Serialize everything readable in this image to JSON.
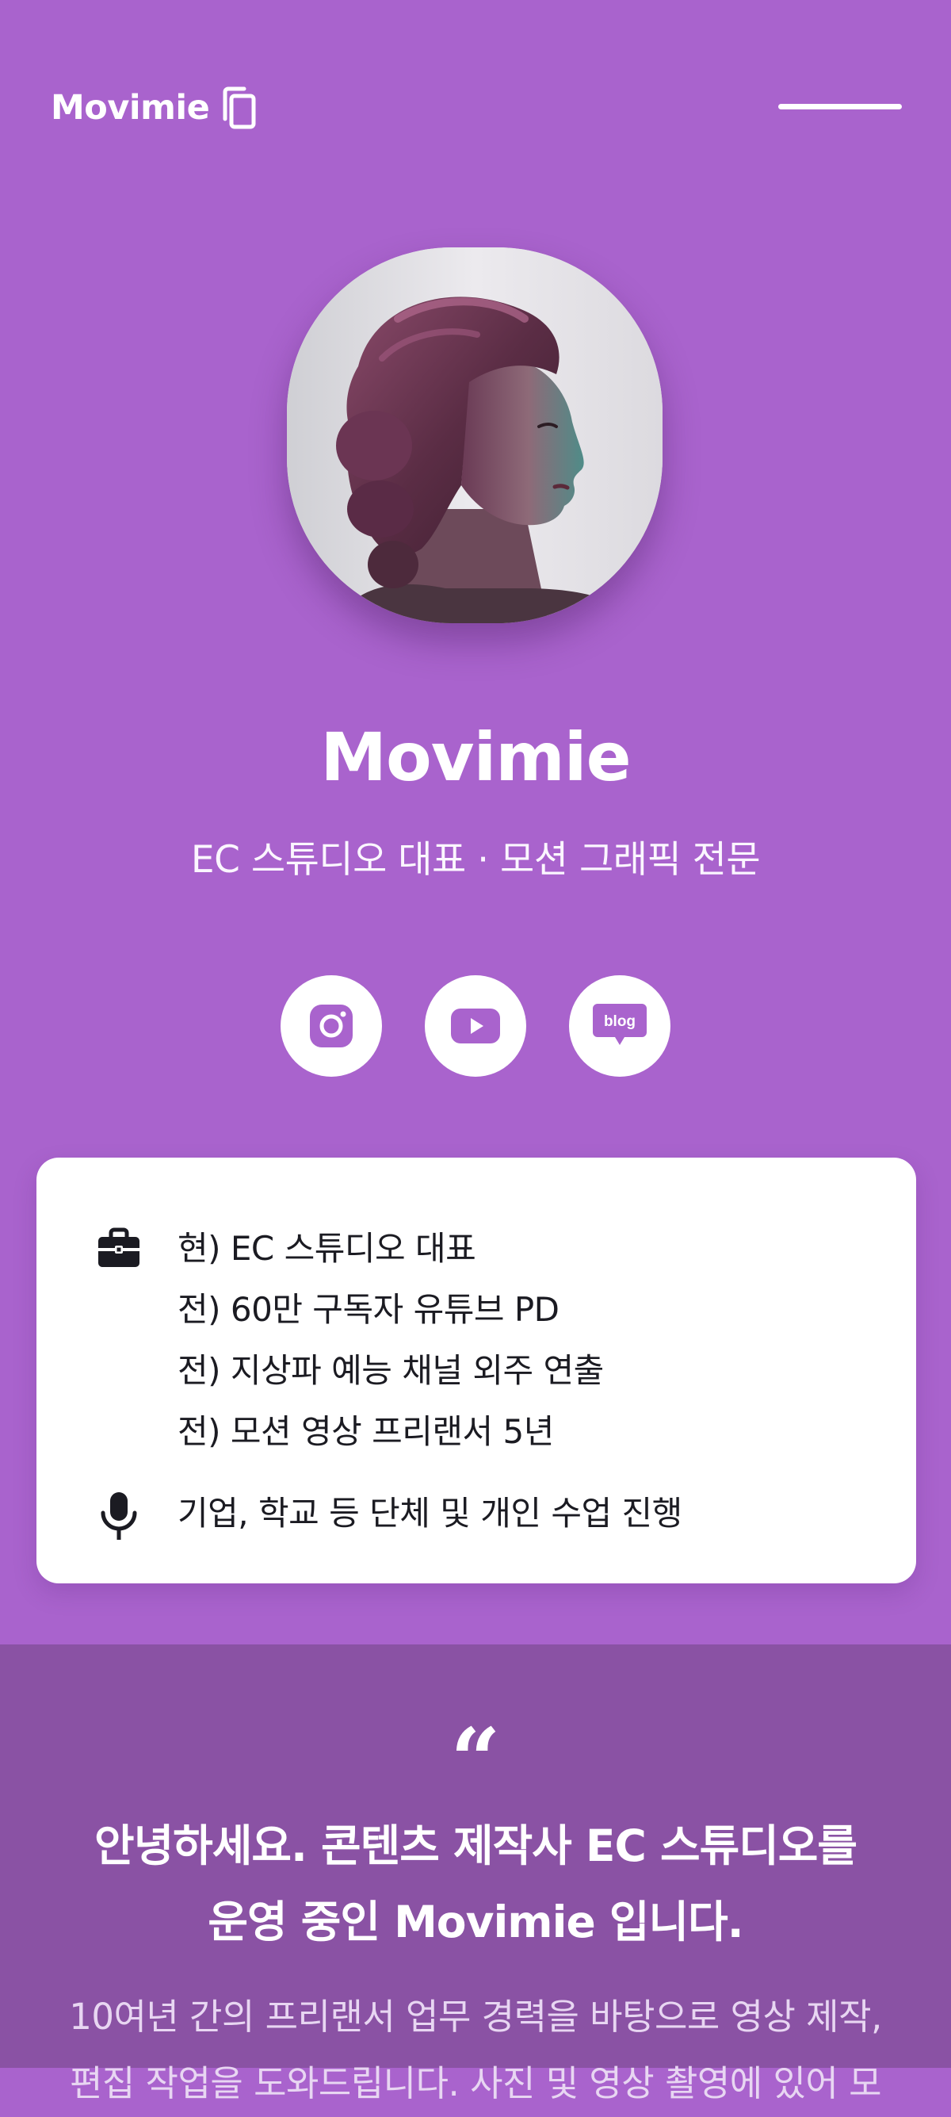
{
  "header": {
    "brand_name": "Movimie",
    "brand_icon": "copy-icon",
    "menu_icon": "menu-icon"
  },
  "profile": {
    "name": "Movimie",
    "subtitle": "EC 스튜디오 대표 · 모션 그래픽 전문",
    "avatar": "portrait-photo"
  },
  "social": [
    {
      "name": "instagram",
      "icon": "instagram-icon"
    },
    {
      "name": "youtube",
      "icon": "youtube-icon"
    },
    {
      "name": "blog",
      "icon": "blog-icon",
      "label": "blog"
    }
  ],
  "career": {
    "icon": "briefcase-icon",
    "items": [
      "현) EC 스튜디오 대표",
      "전) 60만 구독자 유튜브 PD",
      "전) 지상파 예능 채널 외주 연출",
      "전) 모션 영상 프리랜서 5년"
    ]
  },
  "lecture": {
    "icon": "microphone-icon",
    "text": "기업, 학교 등 단체 및 개인 수업 진행"
  },
  "intro": {
    "quote_mark": "“",
    "title_line1": "안녕하세요. 콘텐츠 제작사 EC 스튜디오를",
    "title_line2": "운영 중인 Movimie 입니다.",
    "body_line1": "10여년 간의 프리랜서 업무 경력을 바탕으로 영상 제작,",
    "body_line2": "편집 작업을 도와드립니다. 사진 및 영상 촬영에 있어 모"
  },
  "colors": {
    "background": "#a963cd",
    "intro_background": "#8a52a4",
    "card": "#ffffff",
    "text_dark": "#1b1b22"
  }
}
